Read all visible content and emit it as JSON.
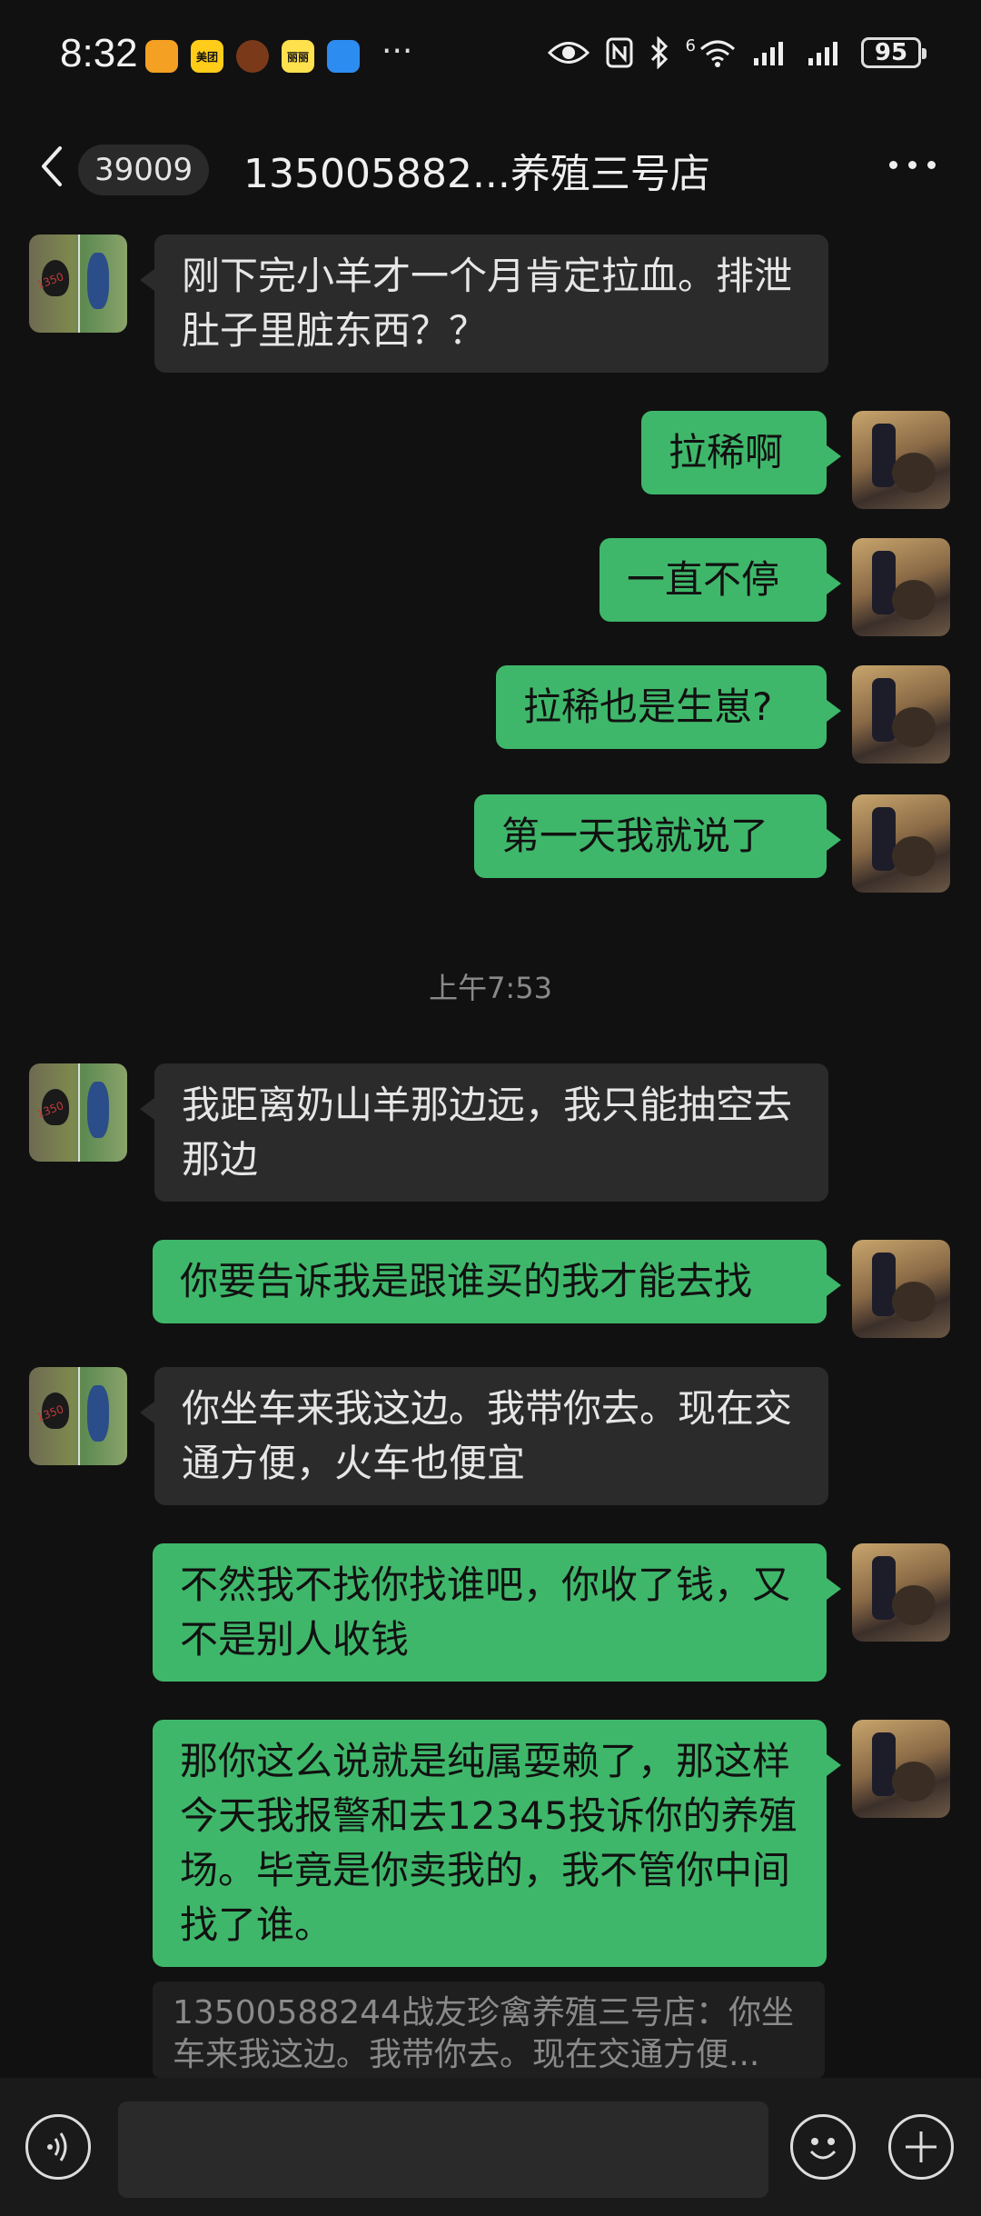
{
  "status_bar": {
    "time": "8:32",
    "app_icons": [
      {
        "name": "app-orange-icon",
        "color": "#f4a023",
        "label": ""
      },
      {
        "name": "meituan-icon",
        "color": "#ffcc1a",
        "label": "美团"
      },
      {
        "name": "avatar-app-icon",
        "color": "#7a3a1a",
        "label": ""
      },
      {
        "name": "app-yellow-icon",
        "color": "#ffe14d",
        "label": "丽丽"
      },
      {
        "name": "cloud-app-icon",
        "color": "#2d8cf0",
        "label": ""
      }
    ],
    "more_glyph": "···",
    "battery": "95",
    "network_label": "6"
  },
  "header": {
    "unread_count": "39009",
    "title": "135005882...养殖三号店"
  },
  "messages": [
    {
      "side": "in",
      "text": "刚下完小羊才一个月肯定拉血。排泄肚子里脏东西？？"
    },
    {
      "side": "out",
      "text": "拉稀啊"
    },
    {
      "side": "out",
      "text": "一直不停"
    },
    {
      "side": "out",
      "text": "拉稀也是生崽?"
    },
    {
      "side": "out",
      "text": "第一天我就说了"
    },
    {
      "side": "in",
      "text": "我距离奶山羊那边远，我只能抽空去那边"
    },
    {
      "side": "out",
      "text": "你要告诉我是跟谁买的我才能去找"
    },
    {
      "side": "in",
      "text": "你坐车来我这边。我带你去。现在交通方便，火车也便宜"
    },
    {
      "side": "out",
      "text": "不然我不找你找谁吧，你收了钱，又不是别人收钱"
    },
    {
      "side": "out",
      "text": "那你这么说就是纯属耍赖了，那这样今天我报警和去12345投诉你的养殖场。毕竟是你卖我的，我不管你中间找了谁。"
    }
  ],
  "timestamp": "上午7:53",
  "quote": {
    "text": "13500588244战友珍禽养殖三号店：你坐车来我这边。我带你去。现在交通方便..."
  },
  "avatar_watermark": "1350",
  "colors": {
    "background": "#111111",
    "incoming_bubble": "#2b2b2b",
    "outgoing_bubble": "#3fb76a"
  }
}
